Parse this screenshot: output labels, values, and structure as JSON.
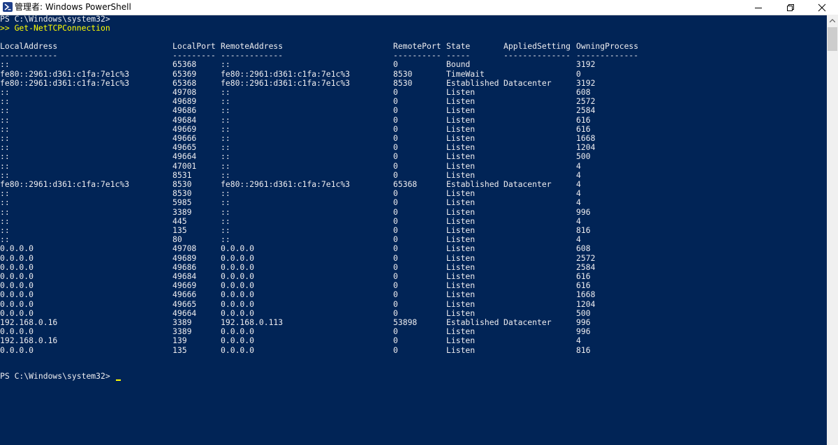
{
  "window": {
    "title": "管理者: Windows PowerShell"
  },
  "console": {
    "prompt1": "PS C:\\Windows\\system32>",
    "command_prefix": ">> ",
    "command": "Get-NetTCPConnection",
    "headers": [
      "LocalAddress",
      "LocalPort",
      "RemoteAddress",
      "RemotePort",
      "State",
      "AppliedSetting",
      "OwningProcess"
    ],
    "separators": [
      "------------",
      "---------",
      "-------------",
      "----------",
      "-----",
      "--------------",
      "-------------"
    ],
    "rows": [
      [
        "::",
        "65368",
        "::",
        "0",
        "Bound",
        "",
        "3192"
      ],
      [
        "fe80::2961:d361:c1fa:7e1c%3",
        "65369",
        "fe80::2961:d361:c1fa:7e1c%3",
        "8530",
        "TimeWait",
        "",
        "0"
      ],
      [
        "fe80::2961:d361:c1fa:7e1c%3",
        "65368",
        "fe80::2961:d361:c1fa:7e1c%3",
        "8530",
        "Established",
        "Datacenter",
        "3192"
      ],
      [
        "::",
        "49708",
        "::",
        "0",
        "Listen",
        "",
        "608"
      ],
      [
        "::",
        "49689",
        "::",
        "0",
        "Listen",
        "",
        "2572"
      ],
      [
        "::",
        "49686",
        "::",
        "0",
        "Listen",
        "",
        "2584"
      ],
      [
        "::",
        "49684",
        "::",
        "0",
        "Listen",
        "",
        "616"
      ],
      [
        "::",
        "49669",
        "::",
        "0",
        "Listen",
        "",
        "616"
      ],
      [
        "::",
        "49666",
        "::",
        "0",
        "Listen",
        "",
        "1668"
      ],
      [
        "::",
        "49665",
        "::",
        "0",
        "Listen",
        "",
        "1204"
      ],
      [
        "::",
        "49664",
        "::",
        "0",
        "Listen",
        "",
        "500"
      ],
      [
        "::",
        "47001",
        "::",
        "0",
        "Listen",
        "",
        "4"
      ],
      [
        "::",
        "8531",
        "::",
        "0",
        "Listen",
        "",
        "4"
      ],
      [
        "fe80::2961:d361:c1fa:7e1c%3",
        "8530",
        "fe80::2961:d361:c1fa:7e1c%3",
        "65368",
        "Established",
        "Datacenter",
        "4"
      ],
      [
        "::",
        "8530",
        "::",
        "0",
        "Listen",
        "",
        "4"
      ],
      [
        "::",
        "5985",
        "::",
        "0",
        "Listen",
        "",
        "4"
      ],
      [
        "::",
        "3389",
        "::",
        "0",
        "Listen",
        "",
        "996"
      ],
      [
        "::",
        "445",
        "::",
        "0",
        "Listen",
        "",
        "4"
      ],
      [
        "::",
        "135",
        "::",
        "0",
        "Listen",
        "",
        "816"
      ],
      [
        "::",
        "80",
        "::",
        "0",
        "Listen",
        "",
        "4"
      ],
      [
        "0.0.0.0",
        "49708",
        "0.0.0.0",
        "0",
        "Listen",
        "",
        "608"
      ],
      [
        "0.0.0.0",
        "49689",
        "0.0.0.0",
        "0",
        "Listen",
        "",
        "2572"
      ],
      [
        "0.0.0.0",
        "49686",
        "0.0.0.0",
        "0",
        "Listen",
        "",
        "2584"
      ],
      [
        "0.0.0.0",
        "49684",
        "0.0.0.0",
        "0",
        "Listen",
        "",
        "616"
      ],
      [
        "0.0.0.0",
        "49669",
        "0.0.0.0",
        "0",
        "Listen",
        "",
        "616"
      ],
      [
        "0.0.0.0",
        "49666",
        "0.0.0.0",
        "0",
        "Listen",
        "",
        "1668"
      ],
      [
        "0.0.0.0",
        "49665",
        "0.0.0.0",
        "0",
        "Listen",
        "",
        "1204"
      ],
      [
        "0.0.0.0",
        "49664",
        "0.0.0.0",
        "0",
        "Listen",
        "",
        "500"
      ],
      [
        "192.168.0.16",
        "3389",
        "192.168.0.113",
        "53898",
        "Established",
        "Datacenter",
        "996"
      ],
      [
        "0.0.0.0",
        "3389",
        "0.0.0.0",
        "0",
        "Listen",
        "",
        "996"
      ],
      [
        "192.168.0.16",
        "139",
        "0.0.0.0",
        "0",
        "Listen",
        "",
        "4"
      ],
      [
        "0.0.0.0",
        "135",
        "0.0.0.0",
        "0",
        "Listen",
        "",
        "816"
      ]
    ],
    "prompt2": "PS C:\\Windows\\system32>"
  },
  "colors": {
    "background": "#012456",
    "text": "#eeedf0",
    "command": "#ffff00"
  },
  "icons": {
    "app": "powershell-icon",
    "minimize": "minimize-icon",
    "maximize": "restore-icon",
    "close": "close-icon"
  }
}
